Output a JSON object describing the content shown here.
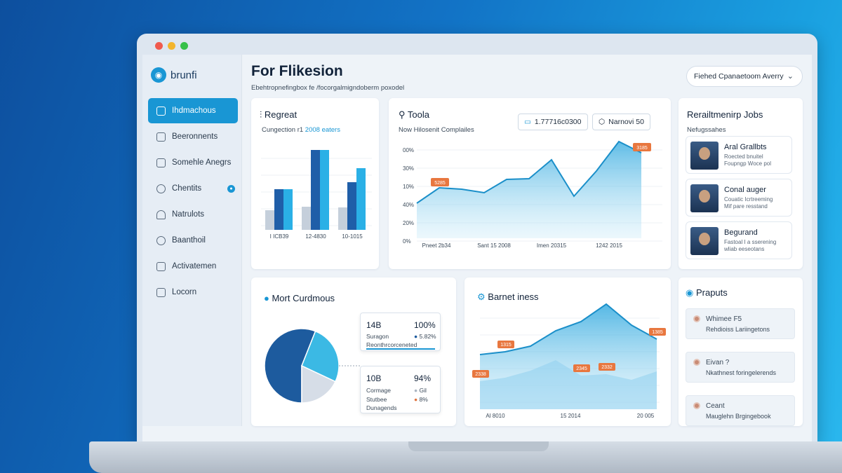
{
  "sidebar": {
    "brand": "brunfi",
    "items": [
      {
        "label": "Ihdmachous"
      },
      {
        "label": "Beeronnents"
      },
      {
        "label": "Somehle Anegrs"
      },
      {
        "label": "Chentits"
      },
      {
        "label": "Natrulots"
      },
      {
        "label": "Baanthoil"
      },
      {
        "label": "Activatemen"
      },
      {
        "label": "Locorn"
      }
    ]
  },
  "header": {
    "title": "For Flikesion",
    "subtitle": "Ebehtropnefingbox fe /focorgalmigndoberm poxodel",
    "dropdown": "Fiehed Cpanaetoom Averry"
  },
  "regreat": {
    "title": "Regreat",
    "sub_prefix": "Cungection r1 ",
    "sub_accent": "2008 eaters",
    "chart_data": {
      "type": "bar",
      "categories": [
        "I ICB39",
        "12-4830",
        "10-1015"
      ],
      "series": [
        {
          "values": [
            28,
            33,
            32
          ]
        },
        {
          "values": [
            58,
            114,
            68
          ]
        },
        {
          "values": [
            58,
            114,
            88
          ]
        }
      ],
      "colors": [
        "#c5cfdb",
        "#1f5ea8",
        "#2ab0e6"
      ]
    }
  },
  "toola": {
    "title": "Toola",
    "sub": "Now Hilosenit Complailes",
    "pill1": "1.77716c0300",
    "pill2": "Narnovi 50",
    "chart_data": {
      "type": "area",
      "yticks": [
        "00%",
        "30%",
        "10%",
        "40%",
        "20%",
        "0%"
      ],
      "xticks": [
        "Pneet 2b34",
        "Sant 15 2008",
        "Imen 20315",
        "1242 2015"
      ],
      "values": [
        50,
        72,
        70,
        65,
        84,
        85,
        112,
        60,
        96,
        138,
        122
      ],
      "markers": [
        {
          "label": "5285",
          "at": 1
        },
        {
          "label": "3185",
          "at": 10
        }
      ]
    }
  },
  "jobs": {
    "title": "Rerailtmenirp Jobs",
    "sub": "Nefugssahes",
    "items": [
      {
        "name": "Aral Grallbts",
        "d1": "Roected bnuitel",
        "d2": "Foupngp Woce pol"
      },
      {
        "name": "Conal auger",
        "d1": "Couatic Icrtreeming",
        "d2": "Mif pare resstand"
      },
      {
        "name": "Begurand",
        "d1": "Fastoal I a sserening",
        "d2": "wliab eeseotans"
      }
    ]
  },
  "mort": {
    "title": "Mort Curdmous",
    "chart_data": {
      "type": "pie",
      "values": [
        56,
        26,
        18
      ],
      "colors": [
        "#1d5b9e",
        "#3bb9e4",
        "#d6dde7"
      ]
    },
    "legend1": {
      "v1": "14B",
      "v2": "100%",
      "l1": "Suragon",
      "p1": "5.82%",
      "l2": "Reonthrcorceneted"
    },
    "legend2": {
      "v1": "10B",
      "v2": "94%",
      "l1": "Cormage",
      "p1": "Gil",
      "l2": "Stutbee",
      "p2": "8%",
      "l3": "Dunagends"
    }
  },
  "barnet": {
    "title": "Barnet iness",
    "chart_data": {
      "type": "area",
      "xticks": [
        "Al 8010",
        "15 2014",
        "20 005"
      ],
      "series1": [
        78,
        82,
        90,
        112,
        125,
        150,
        120,
        100
      ],
      "series2": [
        40,
        45,
        55,
        70,
        48,
        50,
        42,
        54
      ],
      "markers": [
        {
          "label": "1315",
          "at": 1
        },
        {
          "label": "2338",
          "at": 0
        },
        {
          "label": "2345",
          "at": 4
        },
        {
          "label": "2332",
          "at": 5
        },
        {
          "label": "1385",
          "at": 7
        }
      ]
    }
  },
  "praputs": {
    "title": "Praputs",
    "items": [
      {
        "t1": "Whimee F5",
        "t2": "Rehdioiss Lariingetons"
      },
      {
        "t1": "Eivan ?",
        "t2": "Nkathnest foringelerends"
      },
      {
        "t1": "Ceant",
        "t2": "Mauglehn Brgingebook"
      }
    ]
  }
}
